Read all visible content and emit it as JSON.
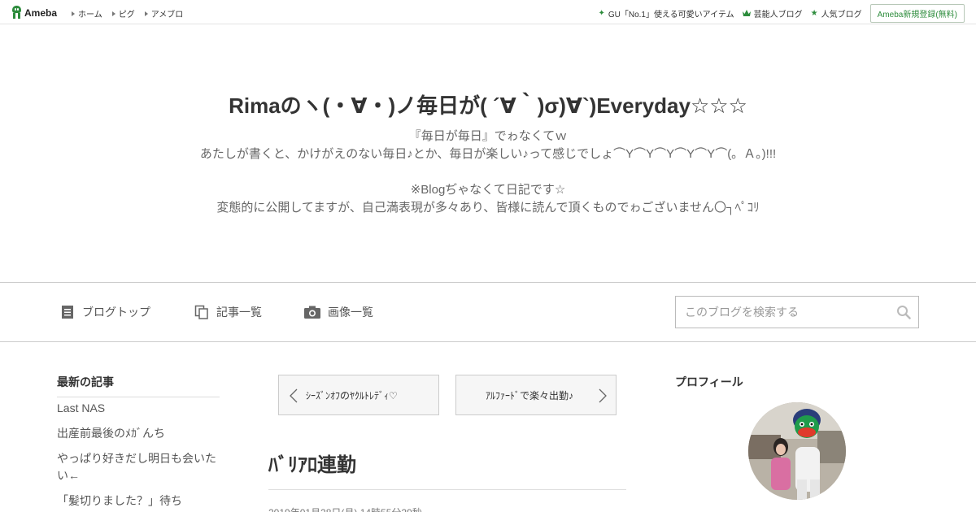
{
  "topbar": {
    "logo_text": "Ameba",
    "nav": [
      "ホーム",
      "ピグ",
      "アメブロ"
    ],
    "links": [
      {
        "icon": "sparkle-icon",
        "label": "GU「No.1」使える可愛いアイテム"
      },
      {
        "icon": "crown-icon",
        "label": "芸能人ブログ"
      },
      {
        "icon": "star-icon",
        "label": "人気ブログ"
      }
    ],
    "signup_label": "Ameba新規登録(無料)"
  },
  "header": {
    "title": "Rimaのヽ(・∀・)ノ毎日が( ´∀｀)σ)∀`)Everyday☆☆☆",
    "desc": [
      "『毎日が毎日』でゎなくてｗ",
      "あたしが書くと、かけがえのない毎日♪とか、毎日が楽しい♪って感じでしょ⌒Y⌒Y⌒Y⌒Y⌒Y⌒(。Ａ。)!!!",
      "",
      "※Blogぢゃなくて日記です☆",
      "変態的に公開してますが、自己満表現が多々あり、皆様に読んで頂くものでゎございません〇┐ﾍﾟｺﾘ"
    ]
  },
  "blognav": {
    "items": [
      "ブログトップ",
      "記事一覧",
      "画像一覧"
    ],
    "search_placeholder": "このブログを検索する"
  },
  "sidebar": {
    "heading": "最新の記事",
    "items": [
      "Last NAS",
      "出産前最後のﾒｶﾞんち",
      "やっぱり好きだし明日も会いたい←",
      "「髪切りました？」待ち"
    ]
  },
  "main": {
    "prev_label": "ｼｰｽﾞﾝｵﾌのﾔｸﾙﾄﾚﾃﾞｨ♡",
    "next_label": "ｱﾙﾌｧｰﾄﾞで楽々出勤♪",
    "entry_title": "ﾊﾞﾘｱﾛ連勤",
    "entry_date": "2019年01月28日(月) 14時55分29秒"
  },
  "profile": {
    "heading": "プロフィール"
  },
  "colors": {
    "ameba_green": "#2d8c3c",
    "text": "#333333",
    "border": "#cccccc"
  }
}
